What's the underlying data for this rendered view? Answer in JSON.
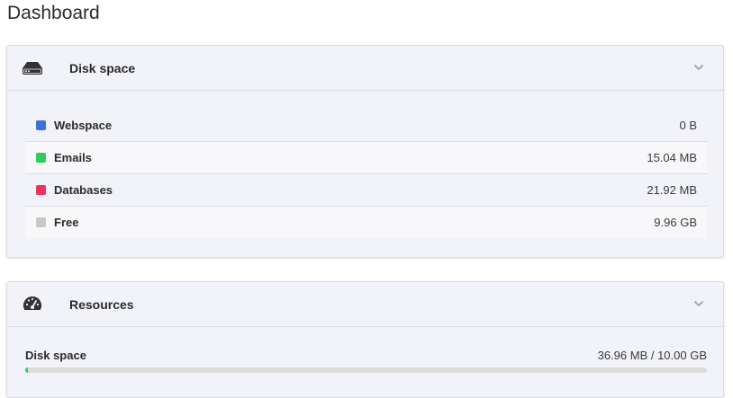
{
  "page": {
    "title": "Dashboard"
  },
  "disk_panel": {
    "title": "Disk space",
    "icon": "hard-drive-icon",
    "items": [
      {
        "label": "Webspace",
        "value": "0 B",
        "color": "#3b73d9"
      },
      {
        "label": "Emails",
        "value": "15.04 MB",
        "color": "#2ecc5a"
      },
      {
        "label": "Databases",
        "value": "21.92 MB",
        "color": "#f0335e"
      },
      {
        "label": "Free",
        "value": "9.96 GB",
        "color": "#c8c8c8"
      }
    ]
  },
  "resources_panel": {
    "title": "Resources",
    "icon": "speedometer-icon",
    "disk_space": {
      "label": "Disk space",
      "value": "36.96 MB / 10.00 GB",
      "usage_fraction": 0.0037,
      "bar_color": "#2ecc40"
    }
  }
}
